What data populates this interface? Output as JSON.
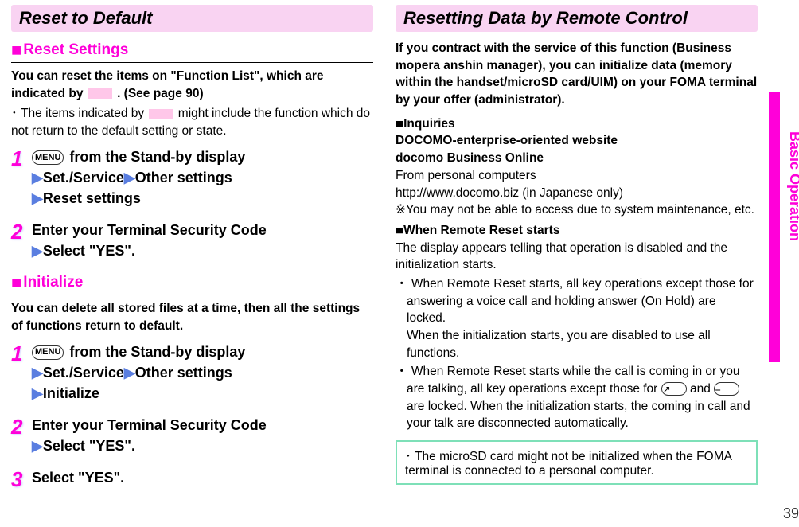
{
  "page_number": "39",
  "side_tab": "Basic Operation",
  "left": {
    "section_title": "Reset to Default",
    "reset_settings": {
      "heading_marker": "■",
      "heading": "Reset Settings",
      "intro_1a": "You can reset the items on \"Function List\", which are indicated by ",
      "intro_1b": ". (See page 90)",
      "note_bullet": "･",
      "note_a": "The items indicated by ",
      "note_b": " might include the function which do not return to the default setting or state.",
      "step1_num": "1",
      "step1_menu": "MENU",
      "step1_a": " from the Stand-by display",
      "step1_b": "Set./Service",
      "step1_c": "Other settings",
      "step1_d": "Reset settings",
      "step2_num": "2",
      "step2_a": "Enter your Terminal Security Code",
      "step2_b": "Select \"YES\"."
    },
    "initialize": {
      "heading_marker": "■",
      "heading": "Initialize",
      "intro": "You can delete all stored files at a time, then all the settings of functions return to default.",
      "step1_num": "1",
      "step1_menu": "MENU",
      "step1_a": " from the Stand-by display",
      "step1_b": "Set./Service",
      "step1_c": "Other settings",
      "step1_d": "Initialize",
      "step2_num": "2",
      "step2_a": "Enter your Terminal Security Code",
      "step2_b": "Select \"YES\".",
      "step3_num": "3",
      "step3_a": "Select \"YES\"."
    }
  },
  "right": {
    "section_title": "Resetting Data by Remote Control",
    "intro": "If you contract with the service of this function (Business mopera anshin manager), you can initialize data (memory within the handset/microSD card/UIM) on your FOMA terminal by your offer (administrator).",
    "inquiries_marker": "■",
    "inquiries_label": "Inquiries",
    "inquiries_title": "DOCOMO-enterprise-oriented website",
    "inquiries_sub": "docomo Business Online",
    "inquiries_from": "From personal computers",
    "inquiries_url": "http://www.docomo.biz (in Japanese only)",
    "inquiries_note_mark": "※",
    "inquiries_note": "You may not be able to access due to system maintenance, etc.",
    "when_marker": "■",
    "when_label": "When Remote Reset starts",
    "when_body": "The display appears telling that operation is disabled and the initialization starts.",
    "bullet1_mark": "・",
    "bullet1_a": "When Remote Reset starts, all key operations except those for answering a voice call and holding answer (On Hold) are locked.",
    "bullet1_b": "When the initialization starts, you are disabled to use all functions.",
    "bullet2_mark": "・",
    "bullet2_a": "When Remote Reset starts while the call is coming in or you are talking, all key operations except those for ",
    "bullet2_key1": "↗",
    "bullet2_and": " and ",
    "bullet2_key2": "⎯",
    "bullet2_b": " are locked. When the initialization starts, the coming in call and your talk are disconnected automatically.",
    "notebox_bullet": "･",
    "notebox": "The microSD card might not be initialized when the FOMA terminal is connected to a personal computer."
  }
}
